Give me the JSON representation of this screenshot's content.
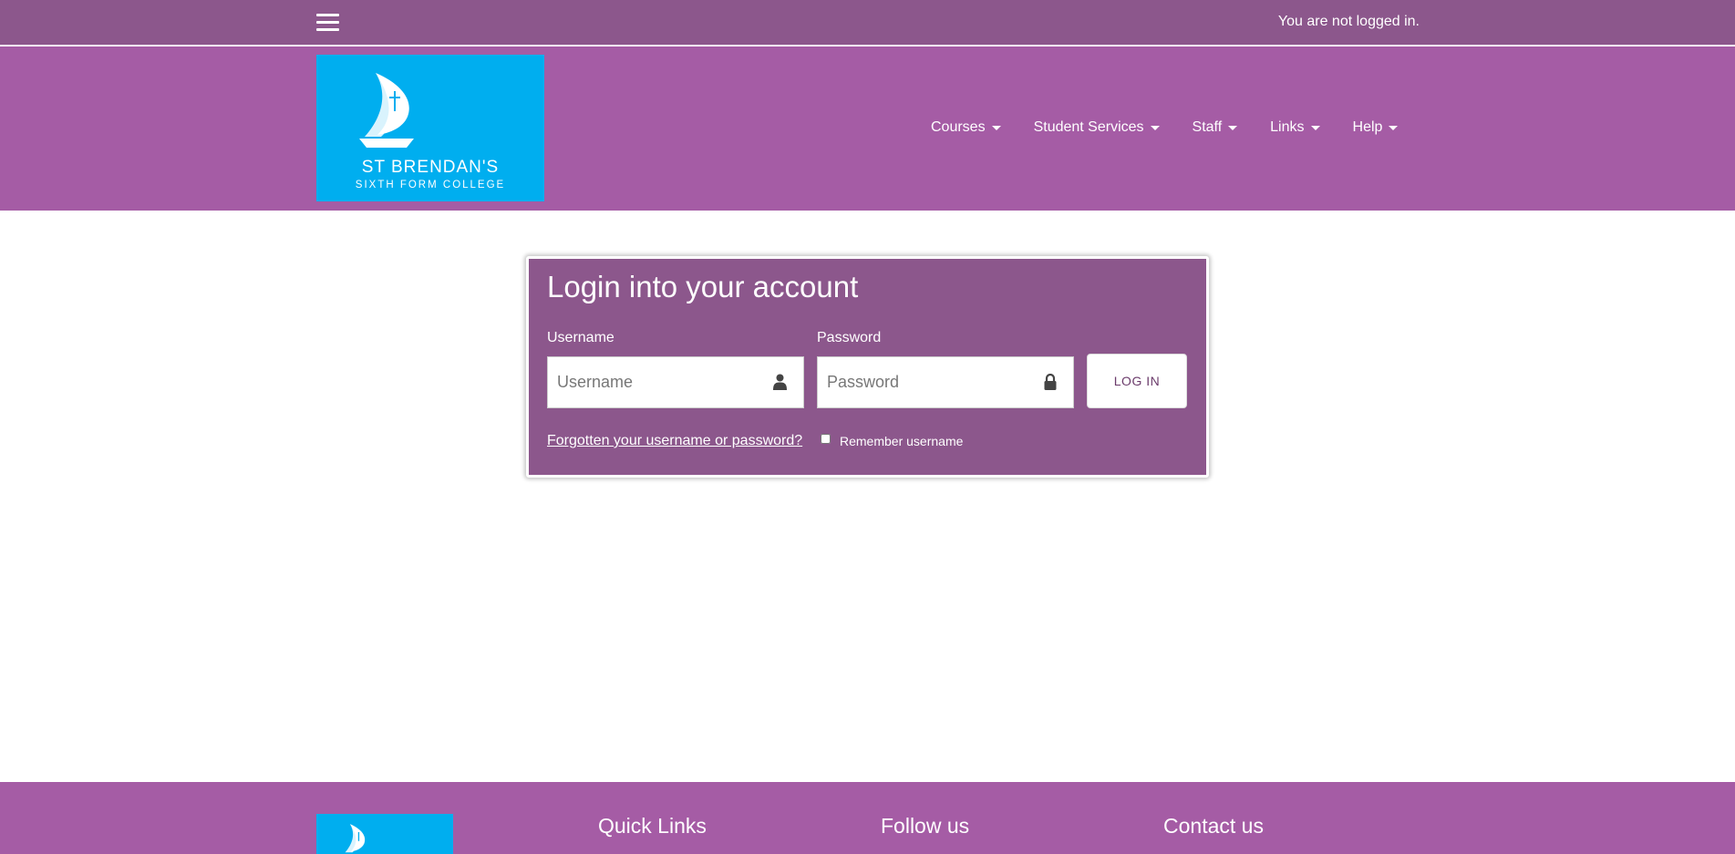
{
  "topbar": {
    "menu_icon": "hamburger-menu-icon",
    "login_status": "You are not logged in."
  },
  "header": {
    "logo": {
      "name": "ST BRENDAN'S",
      "subtitle": "SIXTH FORM COLLEGE"
    },
    "nav": [
      {
        "label": "Courses"
      },
      {
        "label": "Student Services"
      },
      {
        "label": "Staff"
      },
      {
        "label": "Links"
      },
      {
        "label": "Help"
      }
    ]
  },
  "login": {
    "title": "Login into your account",
    "username_label": "Username",
    "username_placeholder": "Username",
    "username_icon": "user-icon",
    "password_label": "Password",
    "password_placeholder": "Password",
    "password_icon": "lock-icon",
    "button_label": "LOG IN",
    "forgot_link": "Forgotten your username or password?",
    "remember_label": "Remember username"
  },
  "footer": {
    "headings": [
      "Quick Links",
      "Follow us",
      "Contact us"
    ]
  },
  "colors": {
    "topbar": "#8c578c",
    "header": "#a55ca5",
    "logo_bg": "#00aeef",
    "card": "#8c578c"
  }
}
